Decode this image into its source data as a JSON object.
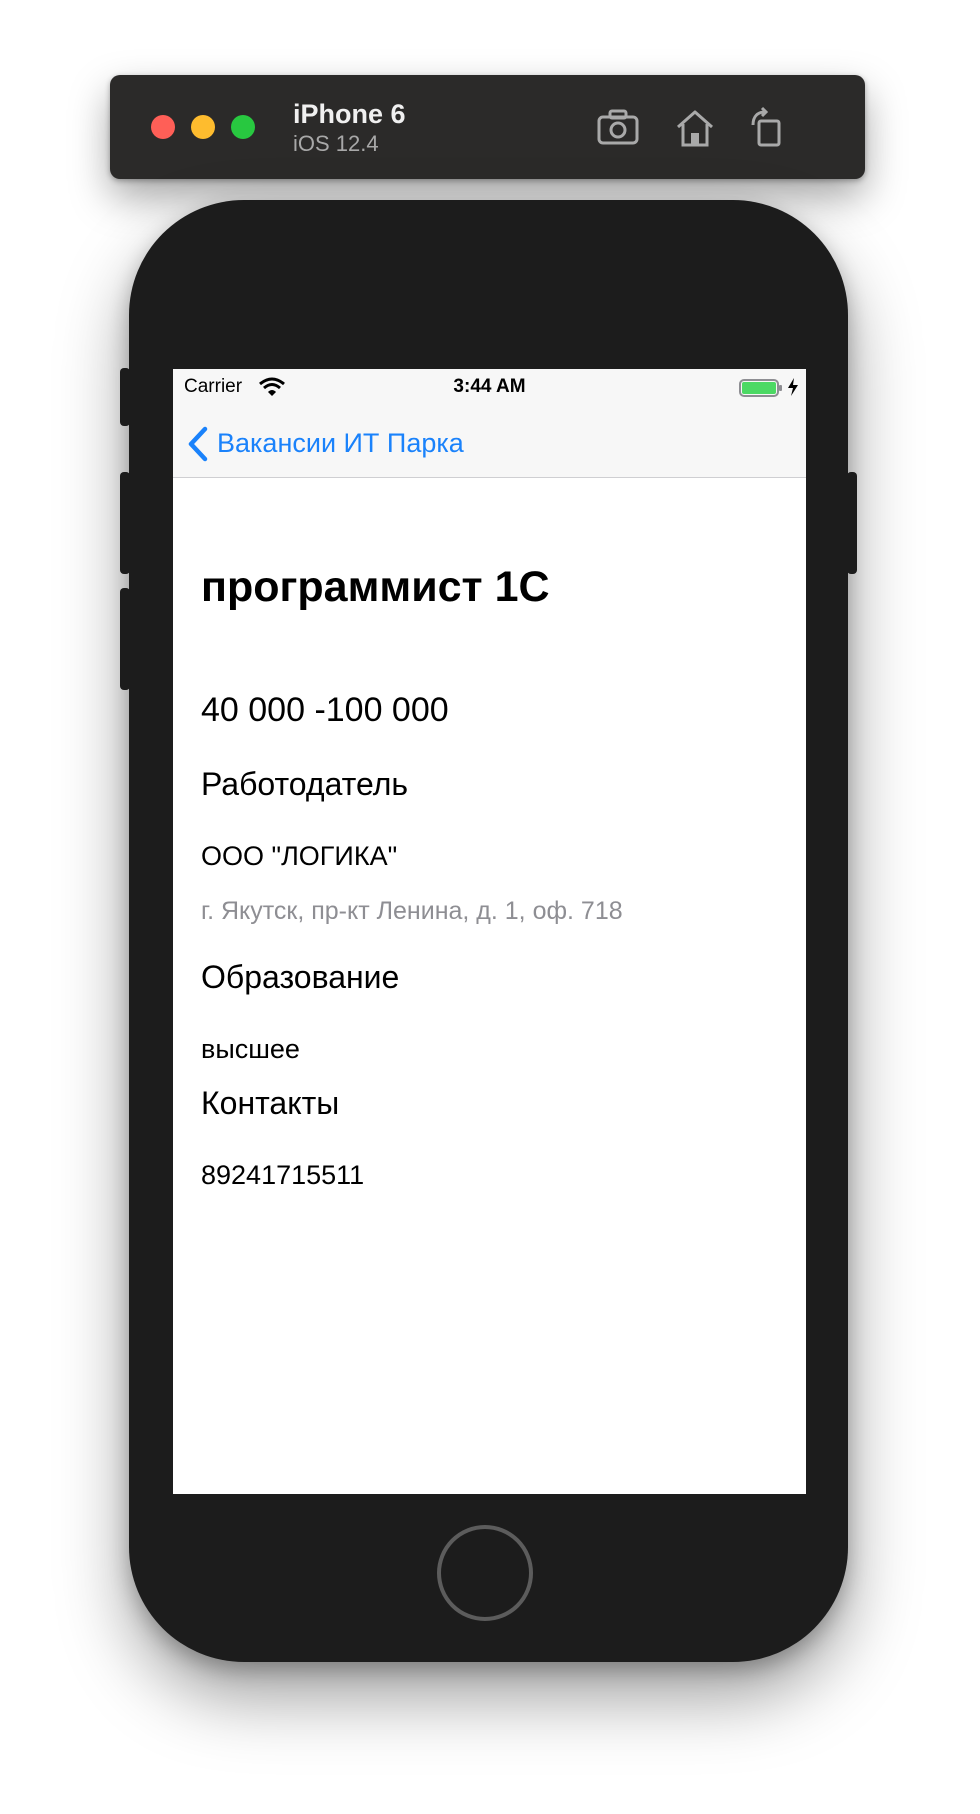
{
  "simulator": {
    "device_name": "iPhone 6",
    "os_version": "iOS 12.4",
    "tools": [
      "screenshot-icon",
      "home-icon",
      "rotate-icon"
    ]
  },
  "status_bar": {
    "carrier": "Carrier",
    "time": "3:44 AM",
    "battery_color": "#4cd964"
  },
  "nav": {
    "back_label": "Вакансии ИТ Парка",
    "accent_color": "#1a82fb"
  },
  "vacancy": {
    "title": "программист 1С",
    "salary": "40 000 -100 000",
    "employer_heading": "Работодатель",
    "employer_name": "ООО \"ЛОГИКА\"",
    "employer_address": "г. Якутск, пр-кт Ленина, д. 1, оф. 718",
    "education_heading": "Образование",
    "education_value": "высшее",
    "contacts_heading": "Контакты",
    "contacts_value": "89241715511"
  }
}
